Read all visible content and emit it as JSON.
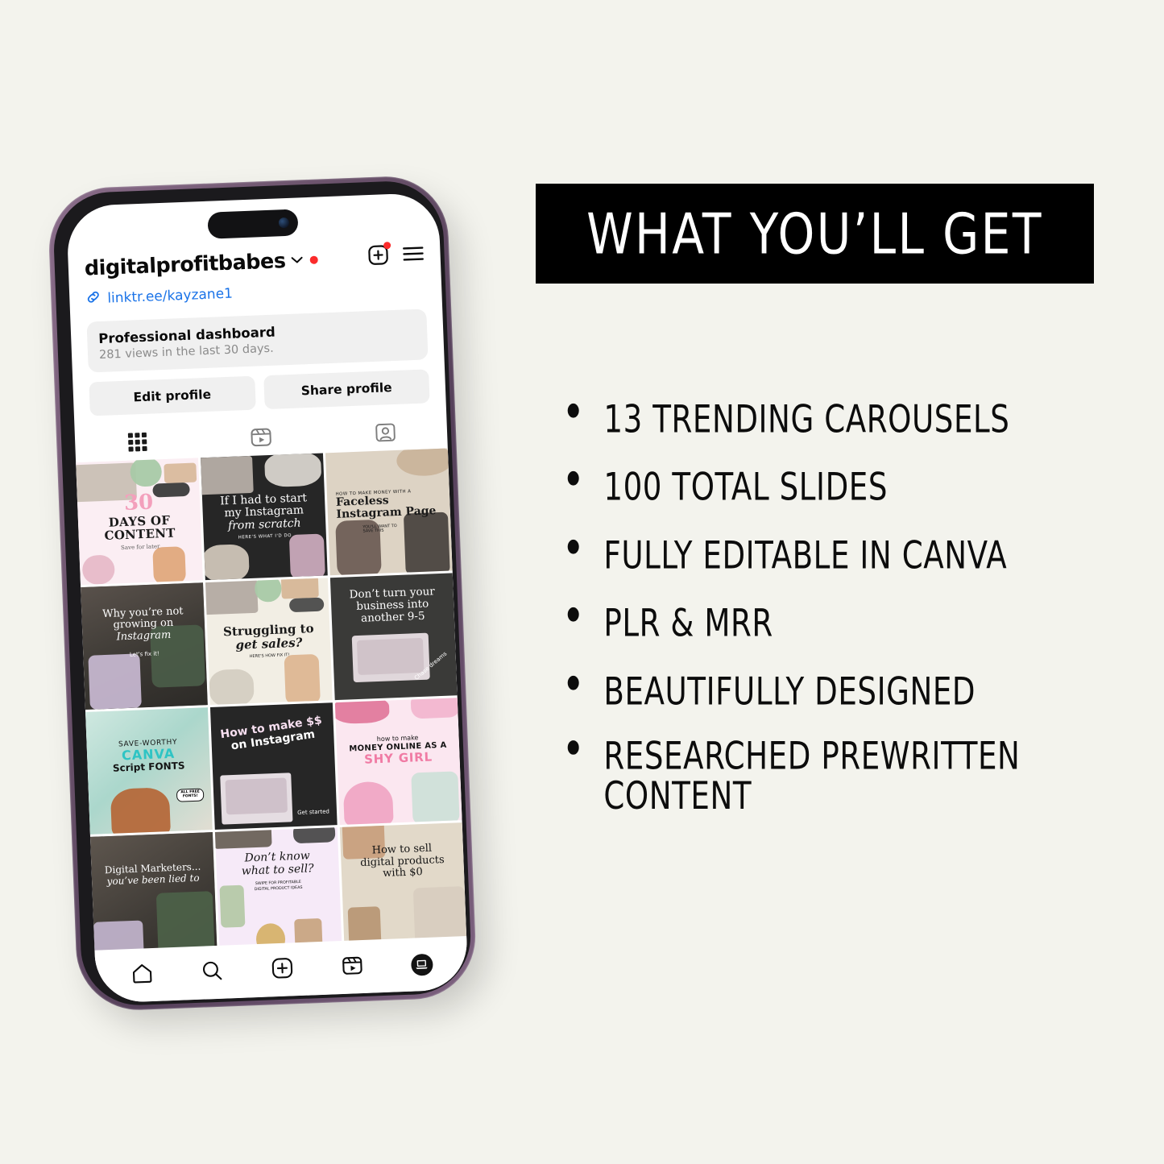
{
  "page": {
    "background_color": "#f3f3ed"
  },
  "right_panel": {
    "headline": "WHAT YOU’LL GET",
    "headline_bg": "#000000",
    "headline_color": "#ffffff",
    "benefits": [
      "13 TRENDING CAROUSELS",
      "100 TOTAL SLIDES",
      "FULLY EDITABLE IN CANVA",
      "PLR & MRR",
      "BEAUTIFULLY DESIGNED",
      "RESEARCHED PREWRITTEN CONTENT"
    ]
  },
  "phone": {
    "frame_color": "#6f566f",
    "bezel_color": "#1b1a1d",
    "app": {
      "header": {
        "username": "digitalprofitbabes",
        "chevron_icon": "chevron-down-icon",
        "unread_dot_color": "#fb2b2b",
        "add_post_icon": "plus-square-icon",
        "menu_icon": "hamburger-menu-icon",
        "link_icon": "link-chain-icon",
        "link_text": "linktr.ee/kayzane1",
        "link_color": "#1a73e8"
      },
      "dashboard": {
        "title": "Professional dashboard",
        "subtitle": "281 views in the last 30 days."
      },
      "buttons": {
        "edit_profile": "Edit profile",
        "share_profile": "Share profile"
      },
      "tabs": [
        {
          "name": "grid-tab",
          "icon": "grid-icon",
          "active": true
        },
        {
          "name": "reels-tab",
          "icon": "reels-icon",
          "active": false
        },
        {
          "name": "tagged-tab",
          "icon": "tagged-person-icon",
          "active": false
        }
      ],
      "grid_posts": [
        {
          "id": 1,
          "theme": "t-pinkpale",
          "lines": [
            "30",
            "DAYS OF",
            "CONTENT"
          ],
          "sub": "Save for later",
          "style": "serif"
        },
        {
          "id": 2,
          "theme": "t-blk",
          "lines": [
            "If I had to start",
            "my Instagram",
            "from scratch"
          ],
          "sub": "HERE'S WHAT I'D DO",
          "style": "serif"
        },
        {
          "id": 3,
          "theme": "t-beige",
          "lines": [
            "HOW TO MAKE MONEY WITH A",
            "Faceless",
            "Instagram Page"
          ],
          "sub": "YOU'LL WANT TO SAVE THIS",
          "style": "serif"
        },
        {
          "id": 4,
          "theme": "t-darkphoto",
          "lines": [
            "Why you’re not",
            "growing on",
            "Instagram"
          ],
          "sub": "Let's fix it!",
          "style": "serif"
        },
        {
          "id": 5,
          "theme": "t-cream",
          "lines": [
            "Struggling to",
            "get sales?"
          ],
          "sub": "HERE'S HOW FIX IT!",
          "style": "serif"
        },
        {
          "id": 6,
          "theme": "t-greyd",
          "lines": [
            "Don’t turn your",
            "business into",
            "another 9-5"
          ],
          "sub": "Chase dreams",
          "style": "serif"
        },
        {
          "id": 7,
          "theme": "t-mint",
          "lines": [
            "SAVE-WORTHY",
            "CANVA",
            "Script FONTS"
          ],
          "sub": "ALL FREE FONTS!",
          "style": "sans"
        },
        {
          "id": 8,
          "theme": "t-blk",
          "lines": [
            "How to make $$",
            "on Instagram"
          ],
          "sub": "Get started",
          "style": "sans"
        },
        {
          "id": 9,
          "theme": "t-pinkhot",
          "lines": [
            "how to make",
            "MONEY ONLINE AS A",
            "SHY GIRL"
          ],
          "sub": "",
          "style": "sans"
        },
        {
          "id": 10,
          "theme": "t-darkphoto",
          "lines": [
            "Digital Marketers...",
            "you’ve been lied to"
          ],
          "sub": "",
          "style": "serif"
        },
        {
          "id": 11,
          "theme": "t-lilac",
          "lines": [
            "Don’t know",
            "what to sell?"
          ],
          "sub": "SWIPE FOR PROFITABLE DIGITAL PRODUCT IDEAS",
          "style": "serif"
        },
        {
          "id": 12,
          "theme": "t-tan",
          "lines": [
            "How to sell",
            "digital products",
            "with $0"
          ],
          "sub": "",
          "style": "serif"
        }
      ],
      "bottom_nav": [
        {
          "name": "nav-home",
          "icon": "home-icon"
        },
        {
          "name": "nav-search",
          "icon": "search-icon"
        },
        {
          "name": "nav-create",
          "icon": "plus-square-icon"
        },
        {
          "name": "nav-reels",
          "icon": "reels-icon"
        },
        {
          "name": "nav-profile",
          "icon": "profile-avatar-icon"
        }
      ]
    }
  }
}
